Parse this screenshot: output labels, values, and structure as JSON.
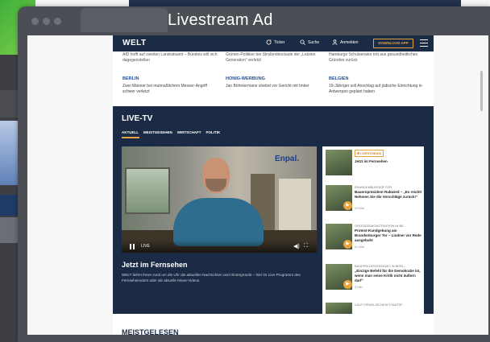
{
  "window": {
    "title": "Livestream Ad"
  },
  "site": {
    "logo": "WELT",
    "header": {
      "ticker_label": "Ticker",
      "search_label": "Suche",
      "login_label": "Anmelden",
      "download_button": "DOWNLOAD APP"
    },
    "top_news": [
      {
        "text": "AfD hofft auf zweiten Landratsamt – Bündnis will sich dagegenstellen"
      },
      {
        "text": "Grünen-Politiker bei Straßenblockade der „Letzten Generation“ verletzt"
      },
      {
        "text": "Hamburgs Schulsenator tritt aus gesundheitlichen Gründen zurück"
      }
    ],
    "categories": [
      {
        "label": "BERLIN",
        "text": "Zwei Männer bei mutmaßlichem Messer-Angriff schwer verletzt"
      },
      {
        "label": "HONIG-WERBUNG",
        "text": "Jan Böhmermann streitet vor Gericht mit Imker"
      },
      {
        "label": "BELGIEN",
        "text": "19-Jähriger soll Anschlag auf jüdische Einrichtung in Antwerpen geplant haben"
      }
    ],
    "live_tv": {
      "title": "LIVE-TV",
      "tabs": [
        "AKTUELL",
        "MEISTGESEHEN",
        "WIRTSCHAFT",
        "POLITIK"
      ],
      "video": {
        "brand": "Enpal.",
        "live_label": "LIVE"
      },
      "now_title": "Jetzt im Fernsehen",
      "now_text": "WELT liefert Ihnen rund um die Uhr die aktuellen Nachrichten und Hintergründe – hier im Live-Programm des Fernsehsenders oder als aktuelle News-Videos.",
      "sidebar": [
        {
          "badge": "LIVESTREAM",
          "kicker": "",
          "title": "Jetzt im Fernsehen",
          "duration": ""
        },
        {
          "badge": "",
          "kicker": "BRANDENBURGER TOR",
          "title": "Bauernpräsident Rukwied – „Es reicht! Nehmen Sie die Vorschläge zurück!“",
          "duration": "20 Min"
        },
        {
          "badge": "",
          "kicker": "GROSSDEMONSTRATION IN BE...",
          "title": "Protest-Kundgebung am Brandenburger Tor – Lindner vor Rede ausgebuht",
          "duration": "21 Min"
        },
        {
          "badge": "",
          "kicker": "BAUERN-GROSSDEMO IN BERL...",
          "title": "„Einzige Befehl für die Demokratie ist, wenn man seine Kritik nicht äußern darf“",
          "duration": "3 Min"
        },
        {
          "badge": "",
          "kicker": "LAUT ISRAELISCHEM STAATSF...",
          "title": "",
          "duration": ""
        }
      ]
    },
    "most_read_title": "MEISTGELESEN"
  },
  "colors": {
    "brand_navy": "#1c2b45",
    "accent_orange": "#e8a341",
    "category_blue": "#1c4fa0"
  }
}
